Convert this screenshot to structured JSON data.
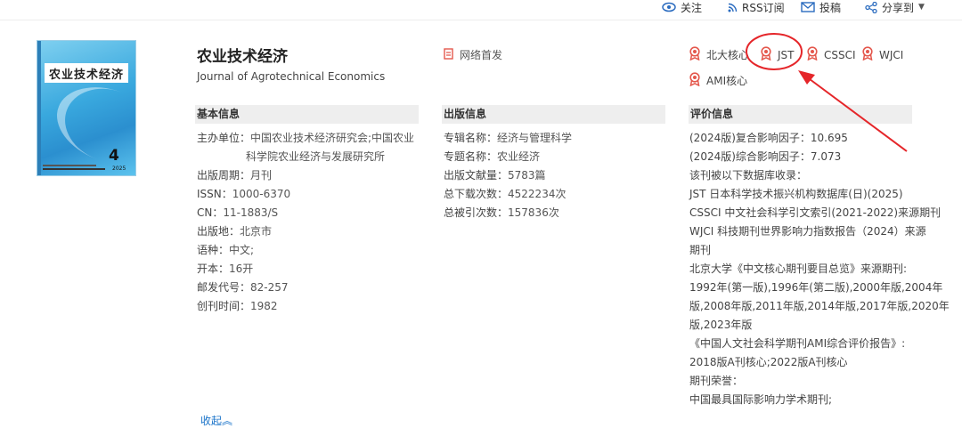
{
  "topbar": {
    "follow": "关注",
    "rss": "RSS订阅",
    "submit": "投稿",
    "share": "分享到"
  },
  "cover": {
    "title": "农业技术经济",
    "issue": "4",
    "year": "2025"
  },
  "journal": {
    "title_cn": "农业技术经济",
    "title_en": "Journal of Agrotechnical Economics",
    "online_first": "网络首发"
  },
  "badges": [
    "北大核心",
    "JST",
    "CSSCI",
    "WJCI",
    "AMI核心"
  ],
  "basic_info": {
    "heading": "基本信息",
    "sponsor_label": "主办单位：",
    "sponsor_line1": "中国农业技术经济研究会;中国农业",
    "sponsor_line2": "科学院农业经济与发展研究所",
    "period_label": "出版周期：",
    "period": "月刊",
    "issn_label": "ISSN：",
    "issn": "1000-6370",
    "cn_label": "CN：",
    "cn": "11-1883/S",
    "place_label": "出版地：",
    "place": "北京市",
    "lang_label": "语种：",
    "lang": "中文;",
    "format_label": "开本：",
    "format": "16开",
    "postal_label": "邮发代号：",
    "postal": "82-257",
    "founded_label": "创刊时间：",
    "founded": "1982"
  },
  "pub_info": {
    "heading": "出版信息",
    "series_label": "专辑名称：",
    "series": "经济与管理科学",
    "topic_label": "专题名称：",
    "topic": "农业经济",
    "count_label": "出版文献量：",
    "count": "5783篇",
    "downloads_label": "总下载次数：",
    "downloads": "4522234次",
    "cited_label": "总被引次数：",
    "cited": "157836次"
  },
  "eval_info": {
    "heading": "评价信息",
    "lines": [
      "(2024版)复合影响因子：10.695",
      "(2024版)综合影响因子：7.073",
      "该刊被以下数据库收录：",
      "JST 日本科学技术振兴机构数据库(日)(2025)",
      "CSSCI 中文社会科学引文索引(2021-2022)来源期刊",
      "WJCI 科技期刊世界影响力指数报告（2024）来源",
      "期刊",
      "北京大学《中文核心期刊要目总览》来源期刊:",
      "1992年(第一版),1996年(第二版),2000年版,2004年",
      "版,2008年版,2011年版,2014年版,2017年版,2020年",
      "版,2023年版",
      "《中国人文社会科学期刊AMI综合评价报告》:",
      "2018版A刊核心;2022版A刊核心",
      "期刊荣誉：",
      "中国最具国际影响力学术期刊;"
    ]
  },
  "collapse": "收起︽",
  "colors": {
    "badge": "#e4574c",
    "annotation": "#e5262a",
    "link": "#1a73c9",
    "header_bg": "#eeeeee"
  }
}
